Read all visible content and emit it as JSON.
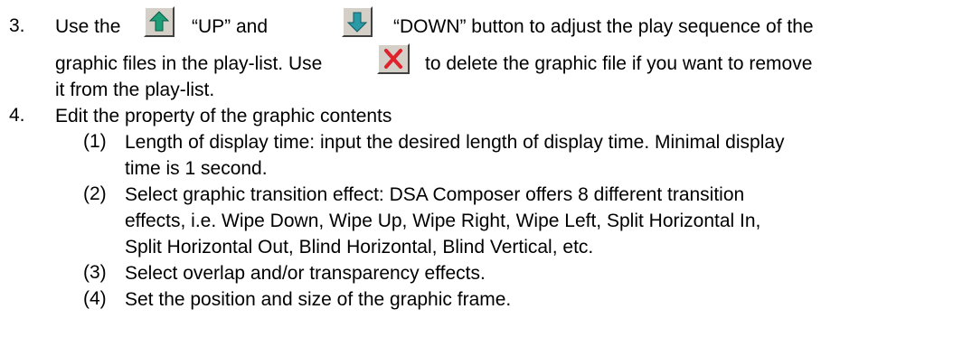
{
  "item3": {
    "number": "3.",
    "line1_a": "Use the",
    "line1_b": "“UP” and",
    "line1_c": "“DOWN” button to adjust the play sequence of the",
    "line2_a": "graphic files in the play-list. Use",
    "line2_b": "to delete the graphic file if you want to remove",
    "line3": "it from the play-list.",
    "icons": [
      "up-arrow-icon",
      "down-arrow-icon",
      "delete-icon"
    ]
  },
  "item4": {
    "number": "4.",
    "text": "Edit the property of the graphic contents",
    "sub": [
      {
        "num": "(1)",
        "lines": [
          "Length of display time: input the desired length of display time. Minimal display",
          "time is 1 second."
        ]
      },
      {
        "num": "(2)",
        "lines": [
          "Select graphic transition effect: DSA Composer offers 8 different transition",
          "effects, i.e. Wipe Down, Wipe Up, Wipe Right, Wipe Left, Split Horizontal In,",
          "Split Horizontal Out, Blind Horizontal, Blind Vertical, etc."
        ]
      },
      {
        "num": "(3)",
        "lines": [
          "Select overlap and/or transparency effects."
        ]
      },
      {
        "num": "(4)",
        "lines": [
          "Set the position and size of the graphic frame."
        ]
      }
    ]
  },
  "colors": {
    "up_arrow": "#1e9e76",
    "down_arrow": "#2a9aa6",
    "delete_x": "#e0202a",
    "button_face": "#d4d0c8"
  }
}
